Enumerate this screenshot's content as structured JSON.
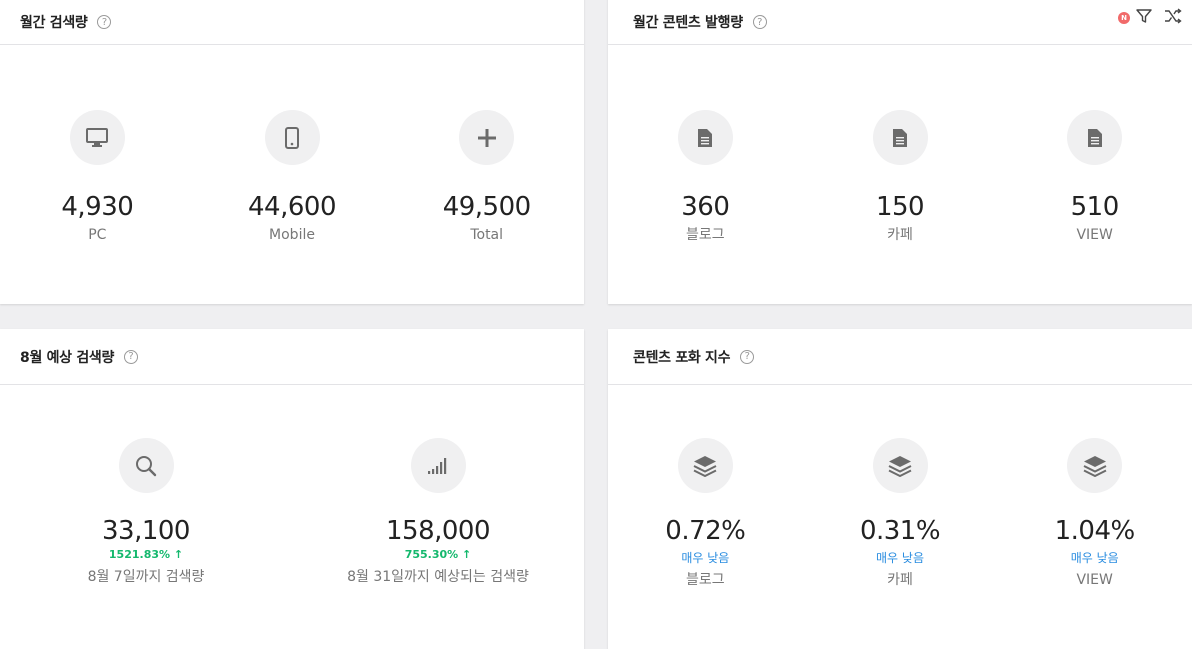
{
  "cards": {
    "monthly_search": {
      "title": "월간 검색량",
      "help": "?",
      "stats": [
        {
          "icon": "monitor-icon",
          "value": "4,930",
          "label": "PC"
        },
        {
          "icon": "mobile-icon",
          "value": "44,600",
          "label": "Mobile"
        },
        {
          "icon": "plus-icon",
          "value": "49,500",
          "label": "Total"
        }
      ]
    },
    "monthly_content": {
      "title": "월간 콘텐츠 발행량",
      "help": "?",
      "badge": "N",
      "tools": [
        "filter-icon",
        "shuffle-icon"
      ],
      "stats": [
        {
          "icon": "document-icon",
          "value": "360",
          "label": "블로그"
        },
        {
          "icon": "document-icon",
          "value": "150",
          "label": "카페"
        },
        {
          "icon": "document-icon",
          "value": "510",
          "label": "VIEW"
        }
      ]
    },
    "forecast": {
      "title": "8월 예상 검색량",
      "help": "?",
      "stats": [
        {
          "icon": "search-icon",
          "value": "33,100",
          "growth": "1521.83%",
          "label": "8월 7일까지 검색량"
        },
        {
          "icon": "signal-bars-icon",
          "value": "158,000",
          "growth": "755.30%",
          "label": "8월 31일까지 예상되는 검색량"
        }
      ]
    },
    "saturation": {
      "title": "콘텐츠 포화 지수",
      "help": "?",
      "stats": [
        {
          "icon": "layers-icon",
          "value": "0.72%",
          "level": "매우 낮음",
          "label": "블로그"
        },
        {
          "icon": "layers-icon",
          "value": "0.31%",
          "level": "매우 낮음",
          "label": "카페"
        },
        {
          "icon": "layers-icon",
          "value": "1.04%",
          "level": "매우 낮음",
          "label": "VIEW"
        }
      ]
    }
  },
  "colors": {
    "growth": "#14b86d",
    "level": "#2a8de0",
    "icon": "#6b6b6b",
    "badge": "#f16a6a"
  }
}
